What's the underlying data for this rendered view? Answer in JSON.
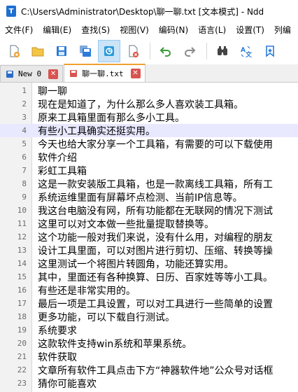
{
  "window": {
    "title": "C:\\Users\\Administrator\\Desktop\\聊一聊.txt [文本模式] - Ndd",
    "icon_letter": "T"
  },
  "menu": [
    "文件(F)",
    "编辑(E)",
    "查找(S)",
    "视图(V)",
    "编码(N)",
    "语言(L)",
    "设置(T)",
    "列编"
  ],
  "toolbar": {
    "buttons": [
      "new-file",
      "open-file",
      "save",
      "save-all",
      "active-tool",
      "close-file",
      "undo",
      "redo",
      "compare",
      "translate",
      "bookmark"
    ],
    "active_index": 4
  },
  "tabs": [
    {
      "label": "New 0",
      "icon_color": "#2b6cc4",
      "active": false
    },
    {
      "label": "聊一聊.txt",
      "icon_color": "#d9534f",
      "active": true
    }
  ],
  "editor": {
    "current_line": 4,
    "lines": [
      {
        "num": "1",
        "text": "聊一聊"
      },
      {
        "num": "2",
        "text": "现在是知道了，为什么那么多人喜欢装工具箱。"
      },
      {
        "num": "3",
        "text": "原来工具箱里面有那么多小工具。"
      },
      {
        "num": "4",
        "text": "有些小工具确实还挺实用。"
      },
      {
        "num": "5",
        "text": "今天也给大家分享一个工具箱，有需要的可以下载使用"
      },
      {
        "num": "6",
        "text": "软件介绍"
      },
      {
        "num": "7",
        "text": "彩虹工具箱"
      },
      {
        "num": "8",
        "text": "这是一款安装版工具箱，也是一款离线工具箱，所有工"
      },
      {
        "num": "9",
        "text": "系统运维里面有屏幕坏点检测、当前IP信息等。"
      },
      {
        "num": "10",
        "text": "我这台电脑没有网，所有功能都在无联网的情况下测试"
      },
      {
        "num": "11",
        "text": "这里可以对文本做一些批量提取替换等。"
      },
      {
        "num": "12",
        "text": "这个功能一般对我们来说，没有什么用，对编程的朋友"
      },
      {
        "num": "13",
        "text": "设计工具里面，可以对图片进行剪切、压缩、转换等操"
      },
      {
        "num": "14",
        "text": "这里测试一个将图片转圆角，功能还算实用。"
      },
      {
        "num": "15",
        "text": "其中，里面还有各种换算、日历、百家姓等等小工具。"
      },
      {
        "num": "16",
        "text": "有些还是非常实用的。"
      },
      {
        "num": "17",
        "text": "最后一项是工具设置，可以对工具进行一些简单的设置"
      },
      {
        "num": "18",
        "text": "更多功能，可以下载自行测试。"
      },
      {
        "num": "19",
        "text": "系统要求"
      },
      {
        "num": "20",
        "text": "这款软件支持win系统和苹果系统。"
      },
      {
        "num": "21",
        "text": "软件获取"
      },
      {
        "num": "22",
        "text": "文章所有软件工具点击下方“神器软件地”公众号对话框"
      },
      {
        "num": "23",
        "text": "猜你可能喜欢"
      }
    ]
  }
}
